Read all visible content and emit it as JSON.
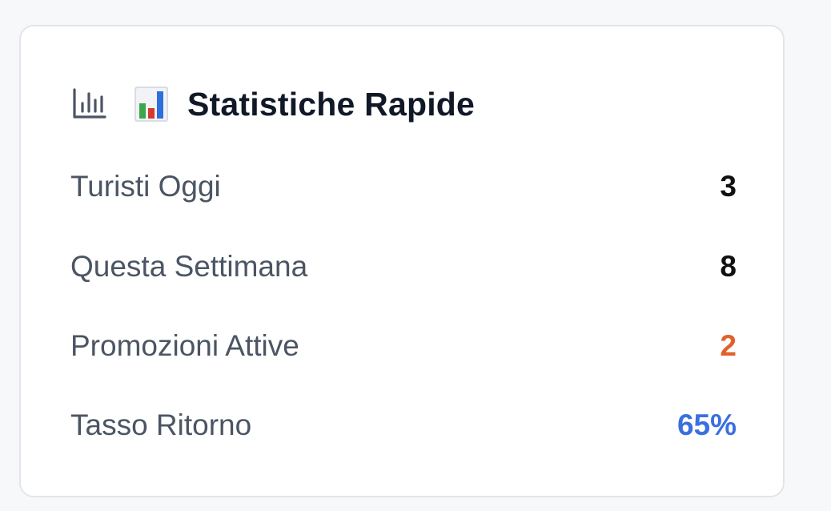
{
  "card": {
    "header": {
      "icon": "bar-chart-line-icon",
      "emoji_icon": "bar-chart-emoji-icon",
      "title": "Statistiche Rapide"
    },
    "stats": [
      {
        "label": "Turisti Oggi",
        "value": "3",
        "color": "#111111"
      },
      {
        "label": "Questa Settimana",
        "value": "8",
        "color": "#111111"
      },
      {
        "label": "Promozioni Attive",
        "value": "2",
        "color": "#e0622a"
      },
      {
        "label": "Tasso Ritorno",
        "value": "65%",
        "color": "#3b6fe0"
      }
    ]
  }
}
